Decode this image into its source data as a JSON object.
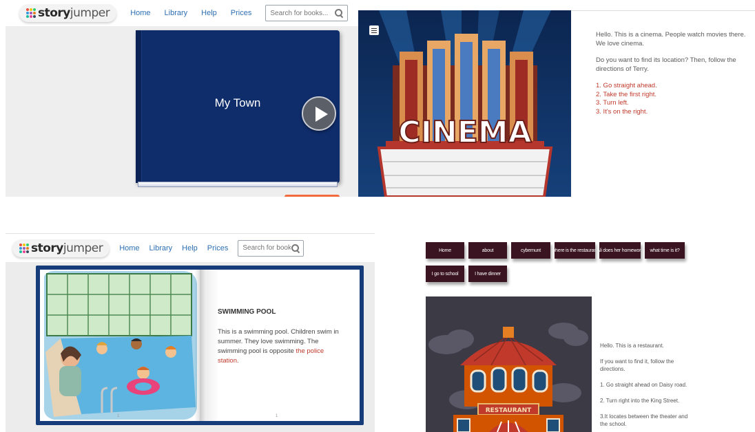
{
  "storyjumper": {
    "logo_main": "story",
    "logo_light": "jumper",
    "nav": [
      "Home",
      "Library",
      "Help",
      "Prices"
    ],
    "search_placeholder": "Search for books..."
  },
  "panel_mytown": {
    "book_title": "My Town"
  },
  "panel_cinema": {
    "sign_text": "CINEMA",
    "intro": "Hello. This is a cinema. People watch movies there. We love cinema.",
    "question": "Do you want to find its location? Then, follow the directions of Terry.",
    "directions": [
      "1. Go straight ahead.",
      "2. Take the first right.",
      "3. Turn left.",
      "3. It's on the right."
    ]
  },
  "panel_pool": {
    "title": "SWIMMING POOL",
    "text": "This is a swimming pool. Children swim in summer. They love swimming. The swimming pool is opposite",
    "link_text": "the police station.",
    "page_left": "1",
    "page_right": "1"
  },
  "panel_restaurant": {
    "nav": [
      "Home",
      "about",
      "cybernunt",
      "where is the restaurant",
      "Ali does her homework",
      "what time is it?",
      "I go to school",
      "I have dinner"
    ],
    "sign_text": "RESTAURANT",
    "lines": [
      "Hello. This is a restaurant.",
      "If you want to find it, follow the directions.",
      "1. Go straight ahead on Daisy road.",
      "2. Turn right into the King Street.",
      "3.It locates between the theater and the school."
    ]
  }
}
